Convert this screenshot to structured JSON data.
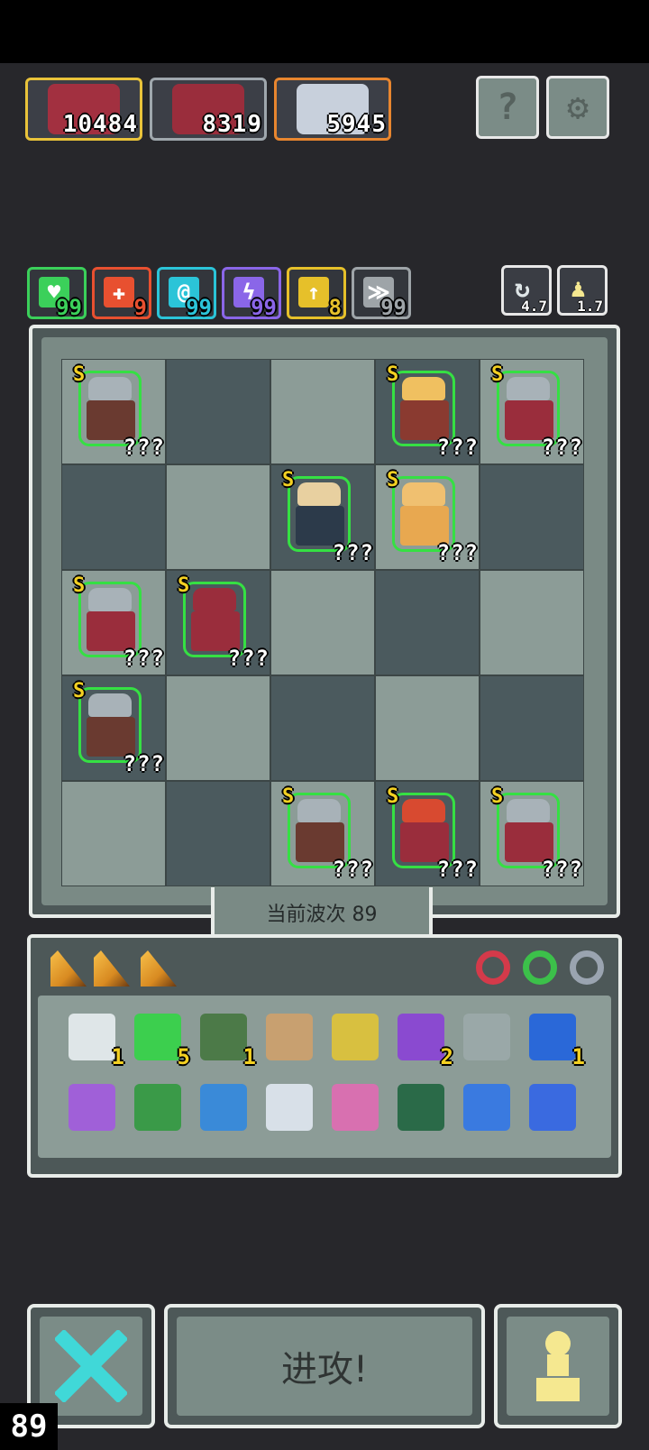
{
  "bosses": [
    {
      "hp": "10484",
      "border": "#e9c33a",
      "face": "#a23040"
    },
    {
      "hp": "8319",
      "border": "#9fa7ad",
      "face": "#9a2d3c"
    },
    {
      "hp": "5945",
      "border": "#e8862f",
      "face": "#c8d0dc"
    }
  ],
  "header_buttons": {
    "help_glyph": "?",
    "settings_glyph": "⚙"
  },
  "stats": [
    {
      "value": "99",
      "color": "#3bd05a",
      "icon": "heart-icon",
      "glyph": "♥"
    },
    {
      "value": "9",
      "color": "#e85030",
      "icon": "attack-icon",
      "glyph": "✚"
    },
    {
      "value": "99",
      "color": "#2bc4d8",
      "icon": "spiral-icon",
      "glyph": "@"
    },
    {
      "value": "99",
      "color": "#8a66e8",
      "icon": "lightning-icon",
      "glyph": "ϟ"
    },
    {
      "value": "8",
      "color": "#e6c02a",
      "icon": "arrow-up-icon",
      "glyph": "↑"
    },
    {
      "value": "99",
      "color": "#9ea4a8",
      "icon": "wing-icon",
      "glyph": "≫"
    }
  ],
  "side_buttons": [
    {
      "value": "4.7",
      "icon": "refresh-icon",
      "glyph": "↻"
    },
    {
      "value": "1.7",
      "icon": "pawn-icon",
      "glyph": "♟"
    }
  ],
  "board": {
    "unit_rank": "S",
    "unit_level": "???",
    "units": [
      {
        "row": 0,
        "col": 0,
        "kind": "shield"
      },
      {
        "row": 0,
        "col": 3,
        "kind": "blonde"
      },
      {
        "row": 0,
        "col": 4,
        "kind": "knight"
      },
      {
        "row": 1,
        "col": 2,
        "kind": "wizard"
      },
      {
        "row": 1,
        "col": 3,
        "kind": "monk"
      },
      {
        "row": 2,
        "col": 0,
        "kind": "knight"
      },
      {
        "row": 2,
        "col": 1,
        "kind": "mage"
      },
      {
        "row": 3,
        "col": 0,
        "kind": "shield"
      },
      {
        "row": 4,
        "col": 2,
        "kind": "shield"
      },
      {
        "row": 4,
        "col": 3,
        "kind": "king"
      },
      {
        "row": 4,
        "col": 4,
        "kind": "knight"
      }
    ],
    "wave_label": "当前波次 89"
  },
  "inventory": {
    "rings": [
      "#d43a4a",
      "#3cc04a",
      "#9aa4b0"
    ],
    "items": [
      {
        "icon": "scroll-icon",
        "count": "1",
        "color": "#dfe6e8"
      },
      {
        "icon": "gem-icon",
        "count": "5",
        "color": "#3ccf4e"
      },
      {
        "icon": "soldier-icon",
        "count": "1",
        "color": "#4c7a48"
      },
      {
        "icon": "claw-icon",
        "count": "",
        "color": "#c8a070"
      },
      {
        "icon": "chalice-icon",
        "count": "",
        "color": "#d8c040"
      },
      {
        "icon": "potion-icon",
        "count": "2",
        "color": "#8a4ad0"
      },
      {
        "icon": "shuriken-icon",
        "count": "",
        "color": "#9aa8a8"
      },
      {
        "icon": "hourglass-icon",
        "count": "1",
        "color": "#2a68d8"
      },
      {
        "icon": "purple-key-icon",
        "count": "",
        "color": "#a060d8"
      },
      {
        "icon": "green-arrow-icon",
        "count": "",
        "color": "#3a9a48"
      },
      {
        "icon": "blue-boot-icon",
        "count": "",
        "color": "#3a8ad8"
      },
      {
        "icon": "mirror-icon",
        "count": "",
        "color": "#d8e0e8"
      },
      {
        "icon": "pink-arrow-icon",
        "count": "",
        "color": "#d870b0"
      },
      {
        "icon": "green-tile-icon",
        "count": "",
        "color": "#2a6a48"
      },
      {
        "icon": "water-drop-icon",
        "count": "",
        "color": "#3a7ae0"
      },
      {
        "icon": "blue-flame-icon",
        "count": "",
        "color": "#3a6ae0"
      }
    ]
  },
  "controls": {
    "attack_label": "进攻!",
    "wave_counter": "89"
  }
}
